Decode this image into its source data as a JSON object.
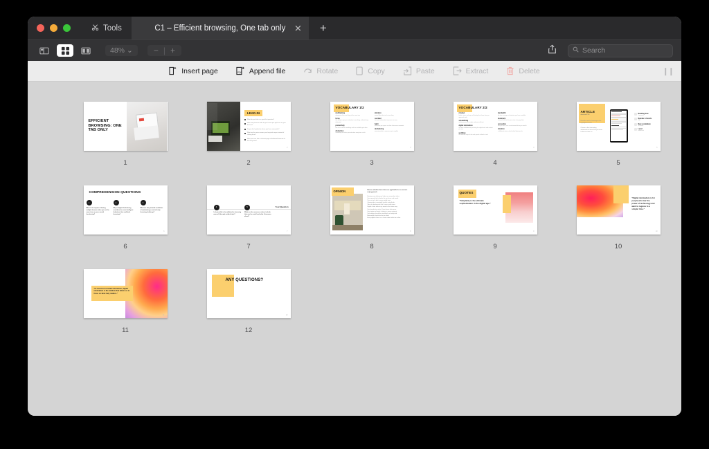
{
  "window": {
    "tools_label": "Tools",
    "tab_title": "C1 – Efficient browsing, One tab only",
    "tab_close": "✕",
    "new_tab": "+"
  },
  "toolbar": {
    "view_sidebar_icon": "sidebar-view-icon",
    "view_grid_icon": "grid-view-icon",
    "view_twopage_icon": "two-page-view-icon",
    "zoom_level": "48%",
    "zoom_caret": "⌄",
    "zoom_out": "−",
    "zoom_sep": "|",
    "zoom_in": "+",
    "share_icon": "share-icon",
    "search_placeholder": "Search"
  },
  "actions": [
    {
      "label": "Insert page",
      "icon": "insert-page-icon",
      "disabled": false
    },
    {
      "label": "Append file",
      "icon": "append-file-icon",
      "disabled": false
    },
    {
      "label": "Rotate",
      "icon": "rotate-icon",
      "disabled": true
    },
    {
      "label": "Copy",
      "icon": "copy-icon",
      "disabled": true
    },
    {
      "label": "Paste",
      "icon": "paste-icon",
      "disabled": true
    },
    {
      "label": "Extract",
      "icon": "extract-icon",
      "disabled": true
    },
    {
      "label": "Delete",
      "icon": "trash-icon",
      "disabled": true
    }
  ],
  "action_handle": "❙❙",
  "colors": {
    "accent_yellow": "#fbcf6e",
    "window_chrome": "#2a2a2c",
    "toolbar": "#333335",
    "actionbar": "#ececec",
    "canvas": "#d4d4d4",
    "delete_red": "#f0a9a5"
  },
  "slides": [
    {
      "number": "1",
      "title": "EFFICIENT BROWSING: ONE TAB ONLY",
      "layout": "title-photo"
    },
    {
      "number": "2",
      "badge": "LEAD-IN",
      "layout": "photo-bullets",
      "bullets": [
        "What do you think is a good first question?",
        "How many browser tabs do you have open right now on your devices?",
        "Do you feel productive when you have many tabs?",
        "What are the main reasons you keep tabs open instead of closing them?",
        "Have you ever lost a relevant page or bookmark because of too many tabs?"
      ],
      "corner": "2"
    },
    {
      "number": "3",
      "badge": "VOCABULARY 1/2",
      "layout": "vocabulary",
      "terms_left": [
        {
          "term": "multitasking",
          "def": "doing more than one thing at the same time"
        },
        {
          "term": "focus",
          "def": "the ability to give your attention to one thing, without being distracted"
        },
        {
          "term": "productivity",
          "def": "the rate at which something useful or valuable gets done"
        },
        {
          "term": "distraction",
          "def": "something that takes your attention away from a task"
        }
      ],
      "terms_right": [
        {
          "term": "attention",
          "def": "mental effort directed at one thing"
        },
        {
          "term": "overload",
          "def": "too much information to process at once"
        },
        {
          "term": "habit",
          "def": "behaviour you repeat so often it becomes automatic"
        },
        {
          "term": "decluttering",
          "def": "removing what is unnecessary to simplify"
        }
      ],
      "corner": "3"
    },
    {
      "number": "4",
      "badge": "VOCABULARY 2/2",
      "layout": "vocabulary",
      "terms_left": [
        {
          "term": "mindset",
          "def": "habits, views and ways of thinking that shape how you approach work"
        },
        {
          "term": "streamlining",
          "def": "making a process simpler and more efficient"
        },
        {
          "term": "digital minimalism",
          "def": "the idea of deliberately reducing the digital tools and content you use"
        },
        {
          "term": "workflow",
          "def": "the ordered steps of the work you do to finish a task"
        }
      ],
      "terms_right": [
        {
          "term": "bandwidth",
          "def": "the time, energy and attention you have available"
        },
        {
          "term": "bookmark",
          "def": "a saved link that lets you return to a page later"
        },
        {
          "term": "accessible",
          "def": "easy to reach, use or understand when you need it"
        },
        {
          "term": "intention",
          "def": "a deliberate aim or plan behind what you do"
        }
      ],
      "corner": "4"
    },
    {
      "number": "5",
      "badge": "ARTICLE",
      "badge_sub": "download PDF",
      "layout": "article-tablet",
      "notes": [
        "Read the article, focusing on the highlighted words.",
        "Choose a few interesting statements or ideas that you want to discuss later on."
      ],
      "stats": [
        {
          "title": "Reading time",
          "sub": "5 minutes"
        },
        {
          "title": "Number of words",
          "sub": "980"
        },
        {
          "title": "New vocabulary",
          "sub": "16 words"
        },
        {
          "title": "Level",
          "sub": "advanced"
        }
      ],
      "corner": "5"
    },
    {
      "number": "6",
      "title": "COMPREHENSION QUESTIONS",
      "layout": "questions-3",
      "items": [
        {
          "n": "1",
          "text": "What is the impact of having multiple browser tabs open at the same time on your mental functioning?"
        },
        {
          "n": "2",
          "text": "Why is digital decluttering considered a more intelligent behaviour than multitask browsing?"
        },
        {
          "n": "3",
          "text": "What are the potential conditions of maintaining a one-tab-only browsing challenge?"
        }
      ],
      "corner": "6"
    },
    {
      "number": "7",
      "layout": "questions-2",
      "items": [
        {
          "n": "4",
          "text": "Is it possible to be addicted to browsing yourself through multiple tabs?"
        },
        {
          "n": "5",
          "text": "What are the resources others include that can be useful and what it becomes about?"
        }
      ],
      "side_label": "Your Question",
      "corner": "7"
    },
    {
      "number": "8",
      "badge": "OPINION",
      "layout": "opinion",
      "prompt": "Discuss whether these ideas are applicable for an one-tab-only approach.",
      "statements": [
        "Having many tabs open helps me remember tasks.",
        "One opened tab is better for my focus and mood.",
        "The cost of a tab is never really zero.",
        "Closing tabs is mentally hard to actually do.",
        "Tabs are bookmarks that I never really open.",
        "Digital clutter affects my mood in the same way.",
        "I feel productive when I have fewer tabs open.",
        "One system of tasks is better in every moment.",
        "Technology should be simplified, not multiplied.",
        "Minimalism should not be an ideal.",
        "Every digital choice is a choice about what we value."
      ],
      "corner": "8"
    },
    {
      "number": "9",
      "badge": "QUOTES",
      "layout": "quote-pink",
      "quote": "\"Simplicity is the ultimate sophistication in the digital age.\"",
      "corner": "9"
    },
    {
      "number": "10",
      "layout": "quote-grad-left",
      "quote": "\"Digital minimalism is for people who fear the power of technology and want to regress to a simpler time.\"",
      "corner": "10"
    },
    {
      "number": "11",
      "layout": "quote-callout",
      "quote": "\"In a world of constant distraction, digital minimalism is the antidote that allows us to focus on what truly matters.\"",
      "corner": "11"
    },
    {
      "number": "12",
      "title": "ANY QUESTIONS?",
      "layout": "closing",
      "corner": "12"
    }
  ]
}
